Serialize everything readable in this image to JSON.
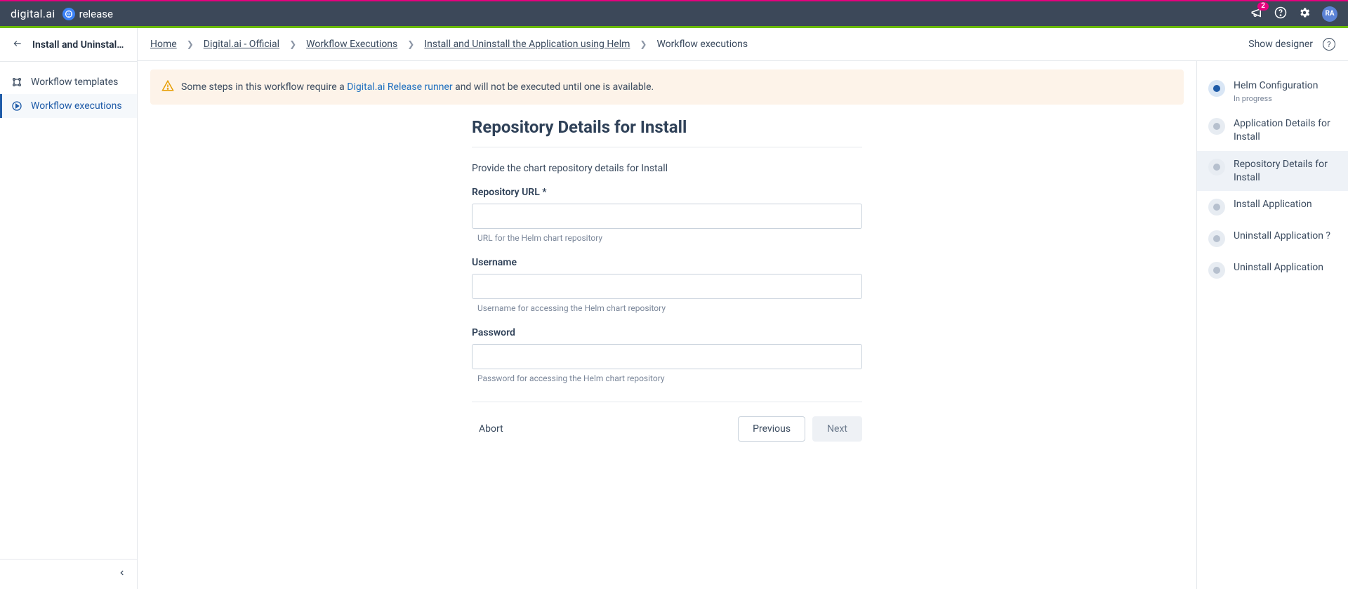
{
  "topbar": {
    "brand": "digital.ai",
    "product": "release",
    "notif_count": "2",
    "avatar_initials": "RA"
  },
  "sidebar": {
    "title": "Install and Uninstall th…",
    "items": [
      {
        "label": "Workflow templates"
      },
      {
        "label": "Workflow executions"
      }
    ]
  },
  "breadcrumbs": {
    "items": [
      "Home",
      "Digital.ai - Official",
      "Workflow Executions",
      "Install and Uninstall the Application using Helm",
      "Workflow executions"
    ],
    "show_designer": "Show designer"
  },
  "banner": {
    "prefix": "Some steps in this workflow require a ",
    "link": "Digital.ai Release runner",
    "suffix": " and will not be executed until one is available."
  },
  "form": {
    "title": "Repository Details for Install",
    "description": "Provide the chart repository details for Install",
    "fields": {
      "repo_url": {
        "label": "Repository URL *",
        "help": "URL for the Helm chart repository",
        "value": ""
      },
      "username": {
        "label": "Username",
        "help": "Username for accessing the Helm chart repository",
        "value": ""
      },
      "password": {
        "label": "Password",
        "help": "Password for accessing the Helm chart repository",
        "value": ""
      }
    },
    "actions": {
      "abort": "Abort",
      "previous": "Previous",
      "next": "Next"
    }
  },
  "steps": [
    {
      "label": "Helm Configuration",
      "sub": "In progress",
      "active": true
    },
    {
      "label": "Application Details for Install"
    },
    {
      "label": "Repository Details for Install",
      "selected": true
    },
    {
      "label": "Install Application"
    },
    {
      "label": "Uninstall Application ?"
    },
    {
      "label": "Uninstall Application"
    }
  ]
}
